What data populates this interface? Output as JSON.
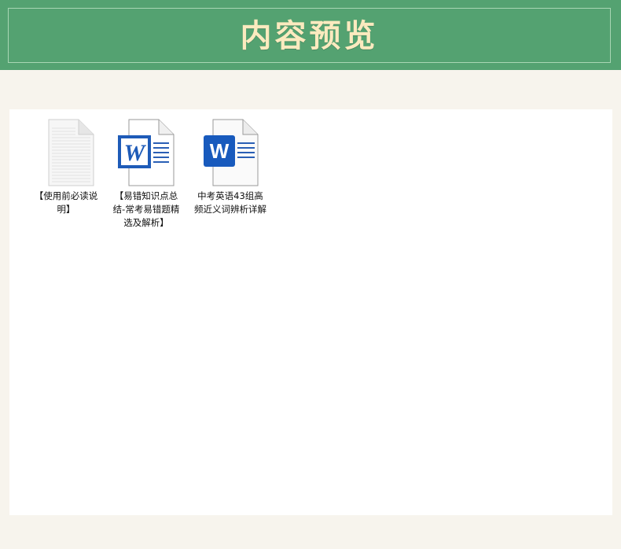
{
  "header": {
    "title": "内容预览"
  },
  "files": [
    {
      "label": "【使用前必读说明】",
      "icon": "text-file-icon"
    },
    {
      "label": "【易错知识点总结-常考易错题精选及解析】",
      "icon": "word-doc-legacy-icon"
    },
    {
      "label": "中考英语43组高频近义词辨析详解",
      "icon": "word-doc-icon"
    }
  ],
  "colors": {
    "header_bg": "#54a271",
    "title": "#fbeabf",
    "page_bg": "#f7f4ed",
    "word_blue": "#1e5bb8"
  }
}
